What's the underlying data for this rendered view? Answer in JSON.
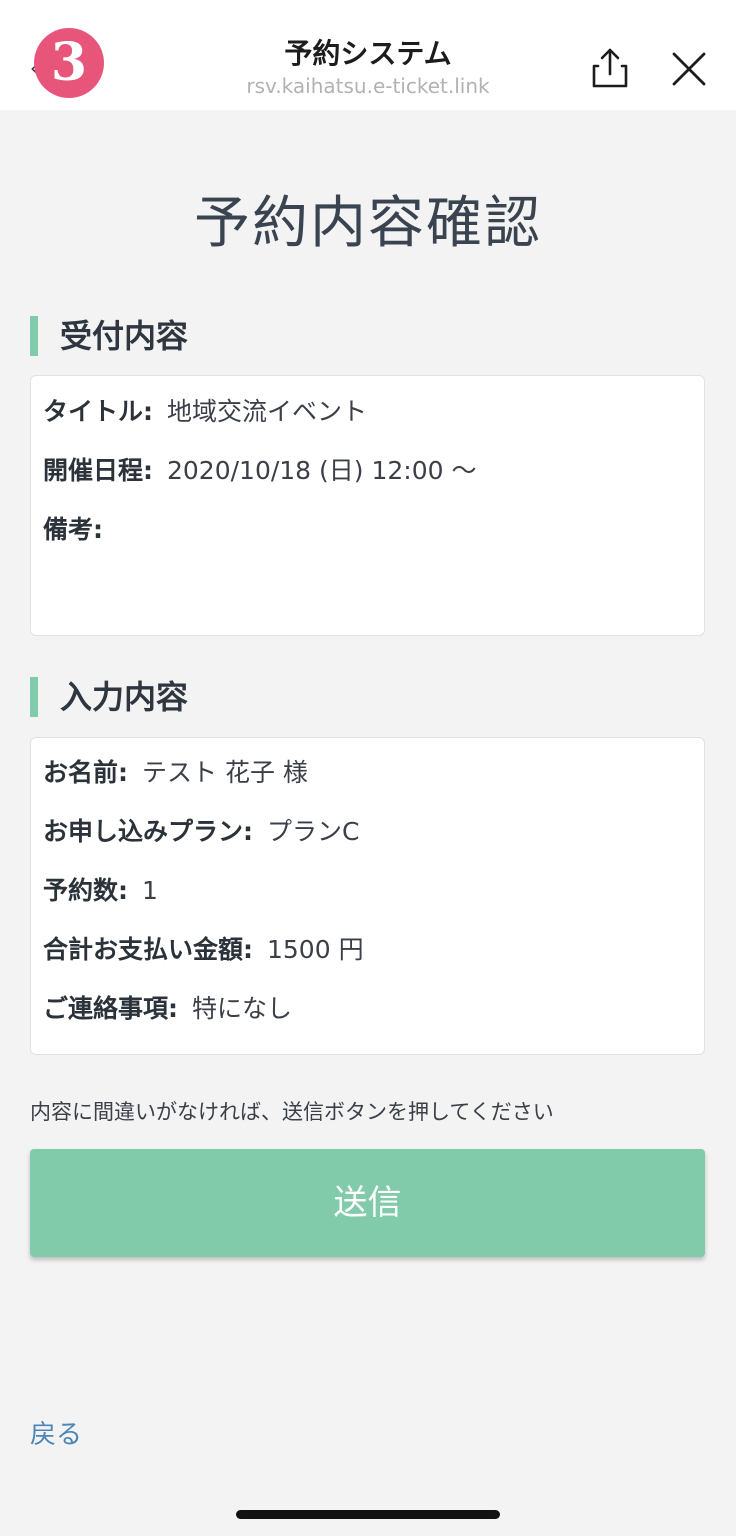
{
  "header": {
    "step_badge": "3",
    "title": "予約システム",
    "url": "rsv.kaihatsu.e-ticket.link"
  },
  "page": {
    "title": "予約内容確認"
  },
  "reception": {
    "heading": "受付内容",
    "rows": [
      {
        "label": "タイトル:",
        "value": "地域交流イベント"
      },
      {
        "label": "開催日程:",
        "value": "2020/10/18 (日) 12:00 〜"
      },
      {
        "label": "備考:",
        "value": ""
      }
    ]
  },
  "input": {
    "heading": "入力内容",
    "rows": [
      {
        "label": "お名前:",
        "value": "テスト 花子 様"
      },
      {
        "label": "お申し込みプラン:",
        "value": "プランC"
      },
      {
        "label": "予約数:",
        "value": "1"
      },
      {
        "label": "合計お支払い金額:",
        "value": "1500 円"
      },
      {
        "label": "ご連絡事項:",
        "value": "特になし"
      }
    ]
  },
  "notice": "内容に間違いがなければ、送信ボタンを押してください",
  "submit_label": "送信",
  "back_label": "戻る",
  "colors": {
    "accent": "#82cbaa",
    "badge": "#e8557b",
    "link": "#4c86b8",
    "background": "#f3f3f3"
  }
}
